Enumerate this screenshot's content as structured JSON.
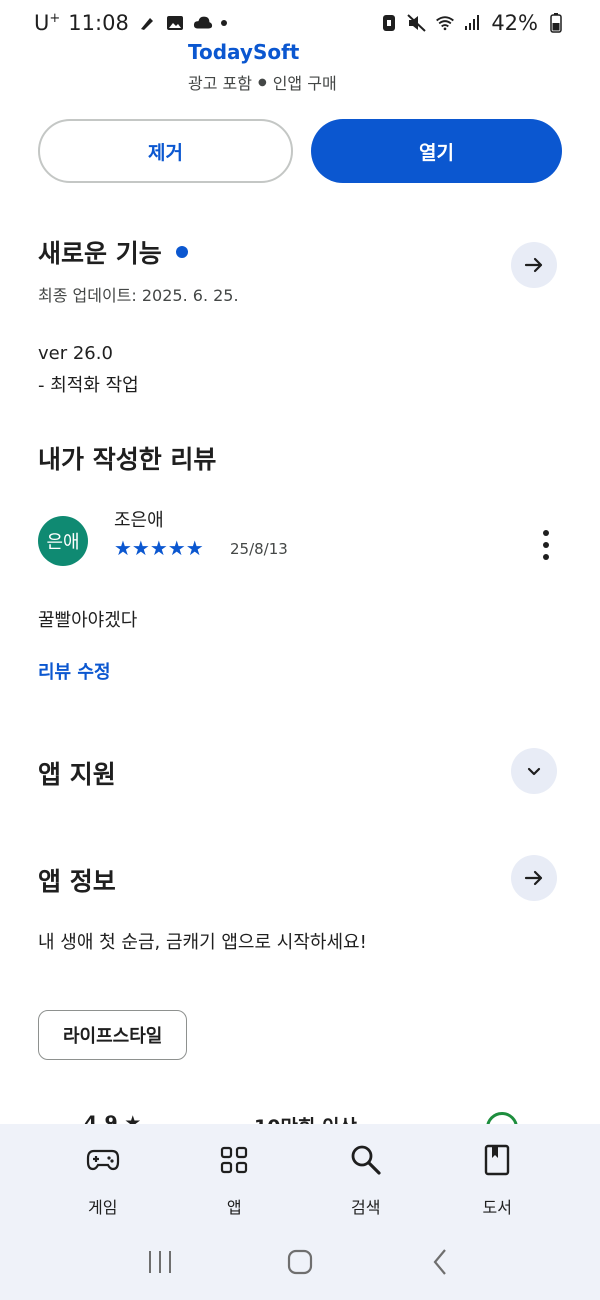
{
  "status_bar": {
    "carrier": "U",
    "carrier_sup": "+",
    "time": "11:08",
    "battery": "42%"
  },
  "app": {
    "name": "TodaySoft",
    "meta_ads": "광고 포함",
    "meta_iap": "인앱 구매"
  },
  "actions": {
    "uninstall_label": "제거",
    "open_label": "열기"
  },
  "whats_new": {
    "title": "새로운 기능",
    "updated": "최종 업데이트: 2025. 6. 25.",
    "version": "ver 26.0",
    "note": "- 최적화 작업"
  },
  "my_review": {
    "title": "내가 작성한 리뷰",
    "avatar_text": "은애",
    "reviewer": "조은애",
    "stars": 5,
    "stars_text": "★★★★★",
    "date": "25/8/13",
    "text": "꿀빨아야겠다",
    "edit_label": "리뷰 수정"
  },
  "support": {
    "title": "앱 지원"
  },
  "info": {
    "title": "앱 정보",
    "description": "내 생애 첫 순금, 금캐기 앱으로 시작하세요!",
    "category_chip": "라이프스타일"
  },
  "stats_partial": {
    "rating": "4.9 ★",
    "downloads": "10만회 이상"
  },
  "bottom_nav": {
    "items": [
      {
        "label": "게임",
        "icon": "gamepad-icon"
      },
      {
        "label": "앱",
        "icon": "apps-grid-icon"
      },
      {
        "label": "검색",
        "icon": "search-icon"
      },
      {
        "label": "도서",
        "icon": "book-icon"
      }
    ]
  },
  "colors": {
    "accent": "#0b57d0",
    "avatar": "#0f8a72",
    "nav_bg": "#eff2f9"
  }
}
